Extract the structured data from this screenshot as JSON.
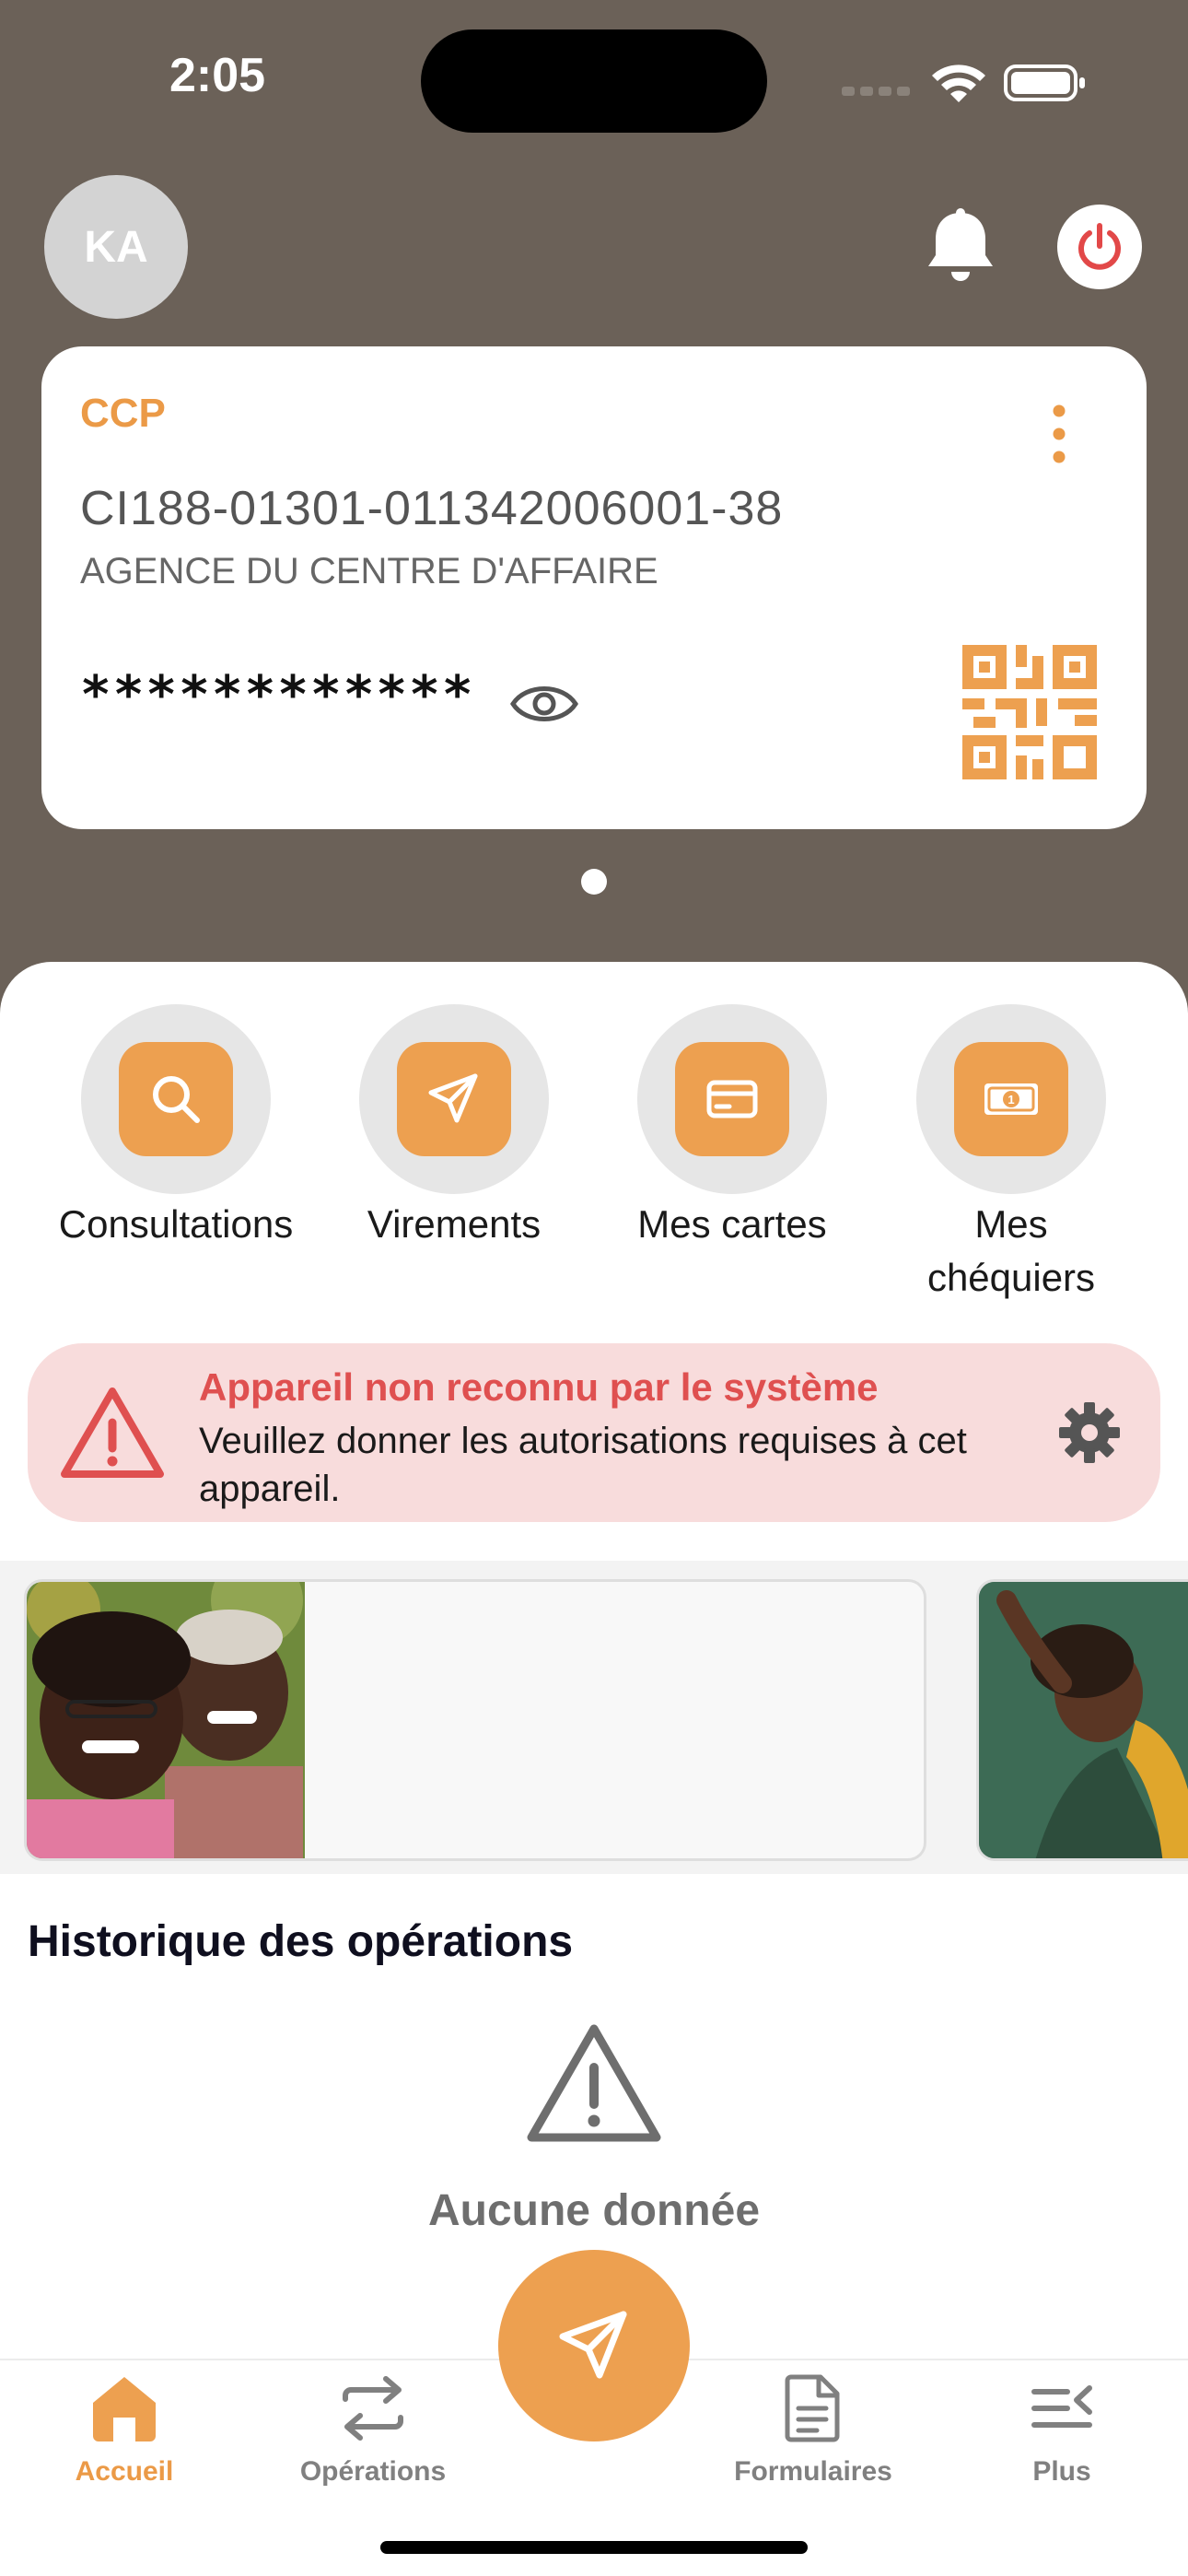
{
  "status_bar": {
    "time": "2:05"
  },
  "header": {
    "avatar_initials": "KA"
  },
  "account_card": {
    "type": "CCP",
    "number": "CI188-01301-011342006001-38",
    "agency": "AGENCE DU CENTRE D'AFFAIRE",
    "balance_masked": "************"
  },
  "quick_actions": [
    {
      "label": "Consultations",
      "icon": "search-icon"
    },
    {
      "label": "Virements",
      "icon": "paper-plane-icon"
    },
    {
      "label": "Mes cartes",
      "icon": "card-icon"
    },
    {
      "label": "Mes\nchéquiers",
      "icon": "banknote-icon"
    }
  ],
  "alert": {
    "title": "Appareil non reconnu par le système",
    "message": "Veuillez donner les autorisations requises à cet appareil."
  },
  "history": {
    "title": "Historique des opérations",
    "empty_text": "Aucune donnée"
  },
  "bottom_nav": {
    "items": [
      {
        "label": "Accueil",
        "icon": "home-icon",
        "active": true
      },
      {
        "label": "Opérations",
        "icon": "transfer-arrows-icon",
        "active": false
      },
      {
        "label": "Formulaires",
        "icon": "document-icon",
        "active": false
      },
      {
        "label": "Plus",
        "icon": "menu-more-icon",
        "active": false
      }
    ]
  },
  "colors": {
    "accent": "#eda050",
    "header_bg": "#6b6158",
    "alert_bg": "#f8dcdc",
    "alert_text": "#df5050"
  }
}
